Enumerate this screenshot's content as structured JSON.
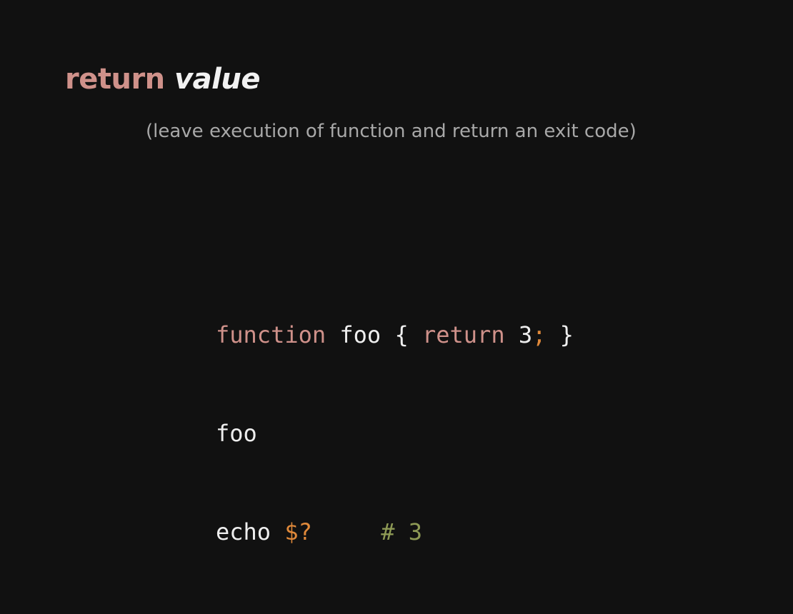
{
  "slide": {
    "title": {
      "keyword": "return",
      "argument": "value"
    },
    "subtitle": "(leave execution of function and return an exit code)",
    "code": {
      "line1": {
        "kw_function": "function",
        "name": " foo { ",
        "kw_return": "return",
        "value": " 3",
        "semicolon": ";",
        "close": " }"
      },
      "line2": {
        "call": "foo"
      },
      "line3": {
        "cmd": "echo ",
        "var": "$?",
        "spacer": "     ",
        "comment": "# 3"
      }
    }
  },
  "colors": {
    "background": "#111111",
    "keyword": "#cf918a",
    "text": "#eeeeee",
    "subtitle": "#a8a8a8",
    "variable": "#e0893a",
    "comment": "#8e9a55"
  }
}
